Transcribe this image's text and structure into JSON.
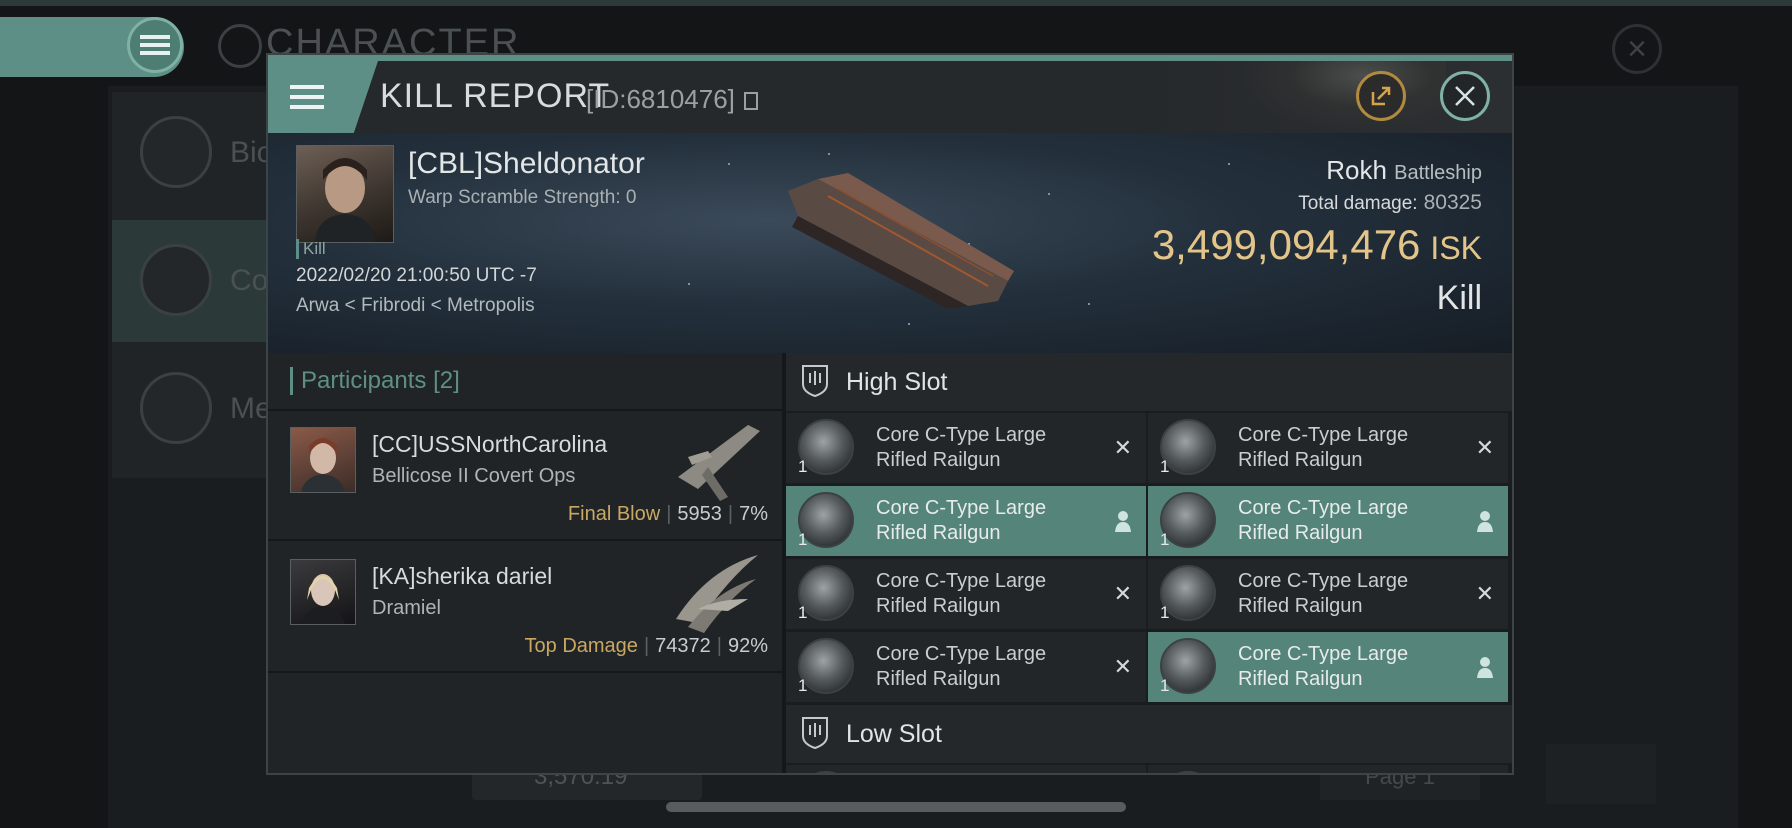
{
  "background": {
    "title": "CHARACTER",
    "sidebar": [
      {
        "label": "Bio"
      },
      {
        "label": "Co"
      },
      {
        "label": "Me"
      }
    ],
    "bottom_value": "3,570.19",
    "page_label": "Page 1"
  },
  "kill_report": {
    "title": "KILL REPORT",
    "id_label": "[ID:6810476]",
    "victim": {
      "name": "[CBL]Sheldonator",
      "warp_scramble": "Warp Scramble Strength: 0",
      "kill_tag": "Kill",
      "timestamp": "2022/02/20 21:00:50 UTC -7",
      "location": "Arwa < Fribrodi < Metropolis"
    },
    "ship": {
      "name": "Rokh",
      "class": "Battleship",
      "total_damage_label": "Total damage:",
      "total_damage": "80325",
      "isk_value": "3,499,094,476",
      "isk_unit": "ISK",
      "result": "Kill"
    },
    "participants": {
      "title": "Participants",
      "count": "[2]",
      "items": [
        {
          "name": "[CC]USSNorthCarolina",
          "ship": "Bellicose II Covert Ops",
          "tag": "Final Blow",
          "damage": "5953",
          "percent": "7%"
        },
        {
          "name": "[KA]sherika dariel",
          "ship": "Dramiel",
          "tag": "Top Damage",
          "damage": "74372",
          "percent": "92%"
        }
      ]
    },
    "high_slot": {
      "title": "High Slot",
      "items": [
        {
          "name": "Core C-Type Large Rifled Railgun",
          "qty": "1",
          "state": "destroyed"
        },
        {
          "name": "Core C-Type Large Rifled Railgun",
          "qty": "1",
          "state": "destroyed"
        },
        {
          "name": "Core C-Type Large Rifled Railgun",
          "qty": "1",
          "state": "dropped"
        },
        {
          "name": "Core C-Type Large Rifled Railgun",
          "qty": "1",
          "state": "dropped"
        },
        {
          "name": "Core C-Type Large Rifled Railgun",
          "qty": "1",
          "state": "destroyed"
        },
        {
          "name": "Core C-Type Large Rifled Railgun",
          "qty": "1",
          "state": "destroyed"
        },
        {
          "name": "Core C-Type Large Rifled Railgun",
          "qty": "1",
          "state": "destroyed"
        },
        {
          "name": "Core C-Type Large Rifled Railgun",
          "qty": "1",
          "state": "dropped"
        }
      ]
    },
    "low_slot": {
      "title": "Low Slot"
    }
  },
  "colors": {
    "accent": "#5e8f86",
    "isk": "#e3c58a",
    "gold": "#c9a862"
  }
}
